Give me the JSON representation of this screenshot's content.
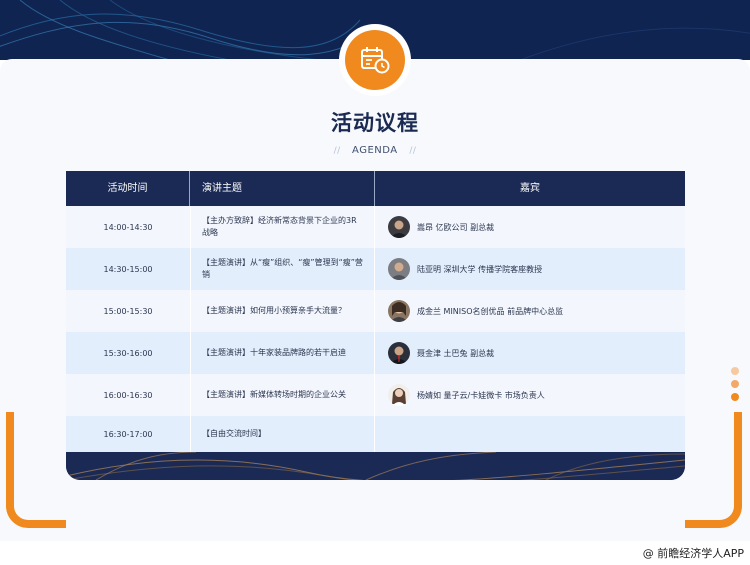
{
  "page": {
    "title": "活动议程",
    "subtitle": "AGENDA",
    "icon": "calendar-clock-icon",
    "accent_color": "#f08a1e",
    "navy_color": "#1b2a55"
  },
  "table": {
    "headers": [
      "活动时间",
      "演讲主题",
      "嘉宾"
    ],
    "rows": [
      {
        "time": "14:00-14:30",
        "topic": "【主办方致辞】经济新常态背景下企业的3R战略",
        "guest": "嵩昂 亿欧公司 副总裁",
        "bg": "#f3f7fd"
      },
      {
        "time": "14:30-15:00",
        "topic": "【主题演讲】从“瘦”组织、“瘦”管理到“瘦”营销",
        "guest": "陆亚明 深圳大学 传播学院客座教授",
        "bg": "#e2eefb"
      },
      {
        "time": "15:00-15:30",
        "topic": "【主题演讲】如何用小预算亲手大流量？",
        "guest": "成金兰 MINISO名创优品 前品牌中心总监",
        "bg": "#f3f7fd"
      },
      {
        "time": "15:30-16:00",
        "topic": "【主题演讲】十年家装品牌路的若干启迪",
        "guest": "聂金津 土巴兔 副总裁",
        "bg": "#e2eefb"
      },
      {
        "time": "16:00-16:30",
        "topic": "【主题演讲】新媒体转场时期的企业公关",
        "guest": "杨婧如 量子云/卡娃微卡 市场负责人",
        "bg": "#f3f7fd"
      },
      {
        "time": "16:30-17:00",
        "topic": "【自由交流时间】",
        "guest": "",
        "bg": "#e2eefb"
      }
    ]
  },
  "dots_colors": [
    "#f7c9a3",
    "#f3a86a",
    "#f08a1e"
  ],
  "watermark": "@ 前瞻经济学人APP"
}
